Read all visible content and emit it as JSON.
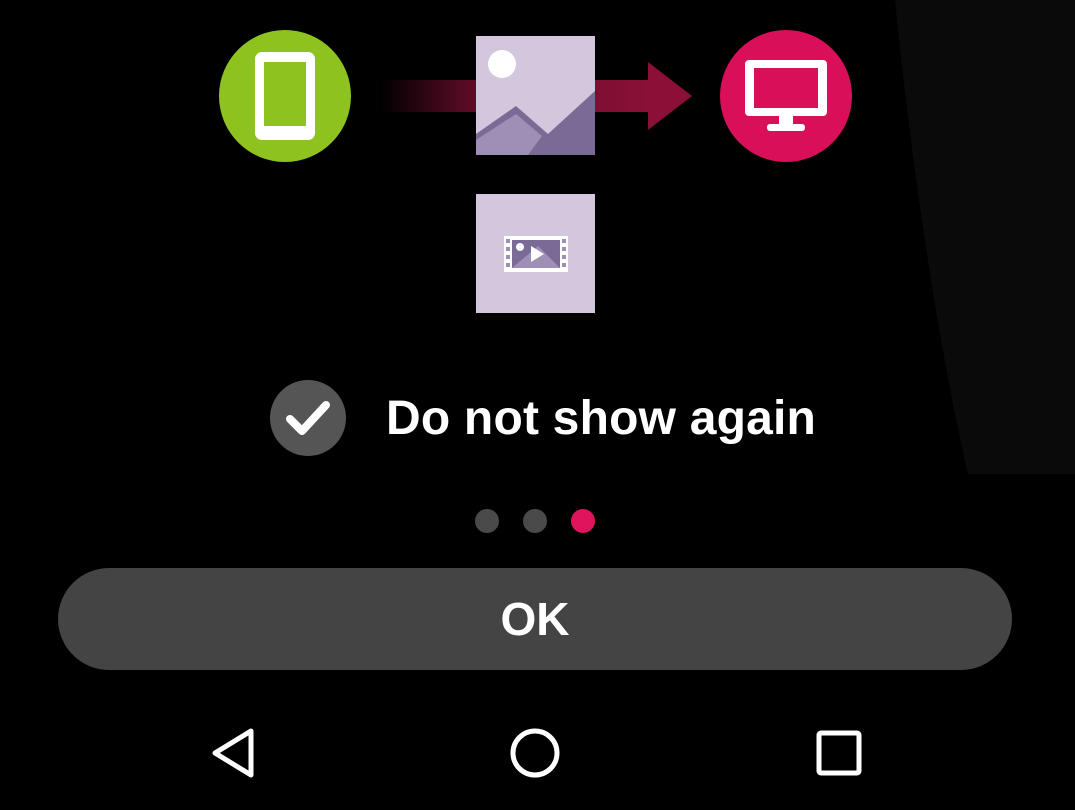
{
  "illustration": {
    "source_icon": "smartphone-icon",
    "target_icon": "monitor-icon",
    "media_icons": [
      "image-icon",
      "video-icon"
    ],
    "source_color": "#8dc21f",
    "target_color": "#d90f5a",
    "arrow_color": "#8a1038",
    "tile_color": "#d2c7dc"
  },
  "dont_show_again": {
    "label": "Do not show again",
    "checked": true,
    "icon": "check-icon",
    "box_color": "#555555"
  },
  "pager": {
    "total": 3,
    "current": 3,
    "active_color": "#e0145c",
    "inactive_color": "#4a4a4a"
  },
  "ok_button": {
    "label": "OK"
  },
  "navbar": {
    "back_icon": "back-icon",
    "home_icon": "home-icon",
    "recents_icon": "recents-icon"
  }
}
